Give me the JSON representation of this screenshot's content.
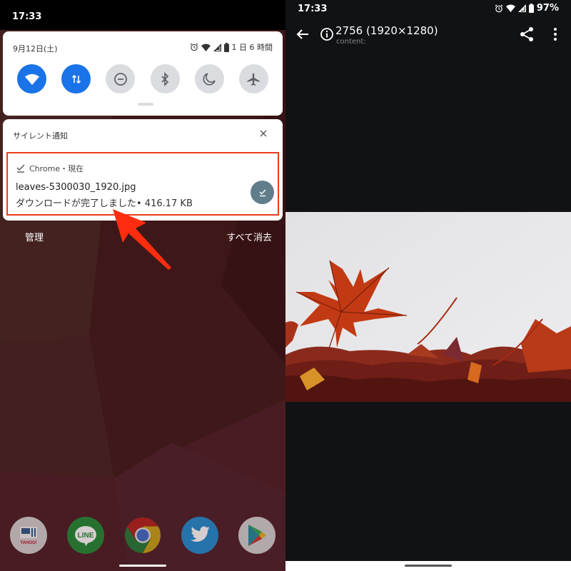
{
  "left": {
    "status_bar": {
      "time": "17:33"
    },
    "quick_settings": {
      "date": "9月12日(土)",
      "battery_remaining": "1 日 6 時間",
      "tiles": [
        {
          "name": "wifi",
          "state": "on"
        },
        {
          "name": "mobile-data",
          "state": "on"
        },
        {
          "name": "do-not-disturb",
          "state": "off"
        },
        {
          "name": "bluetooth",
          "state": "off"
        },
        {
          "name": "night-mode",
          "state": "off"
        },
        {
          "name": "airplane-mode",
          "state": "off"
        }
      ]
    },
    "notification_section": {
      "header": "サイレント通知",
      "notification": {
        "app": "Chrome・現在",
        "title": "leaves-5300030_1920.jpg",
        "body": "ダウンロードが完了しました• 416.17 KB"
      }
    },
    "footer": {
      "manage_label": "管理",
      "clear_all_label": "すべて消去"
    },
    "dock_apps": [
      {
        "name": "yahoo-news",
        "label": "YAHOO!"
      },
      {
        "name": "line",
        "label": "LINE"
      },
      {
        "name": "chrome",
        "label": ""
      },
      {
        "name": "twitter",
        "label": ""
      },
      {
        "name": "play-store",
        "label": ""
      }
    ],
    "annotation_color": "#ea3a1e"
  },
  "right": {
    "status_bar": {
      "time": "17:33",
      "battery": "97%"
    },
    "toolbar": {
      "title": "2756 (1920×1280)",
      "subtitle": "content:"
    },
    "image_description": "Red autumn maple leaves on a white background"
  }
}
